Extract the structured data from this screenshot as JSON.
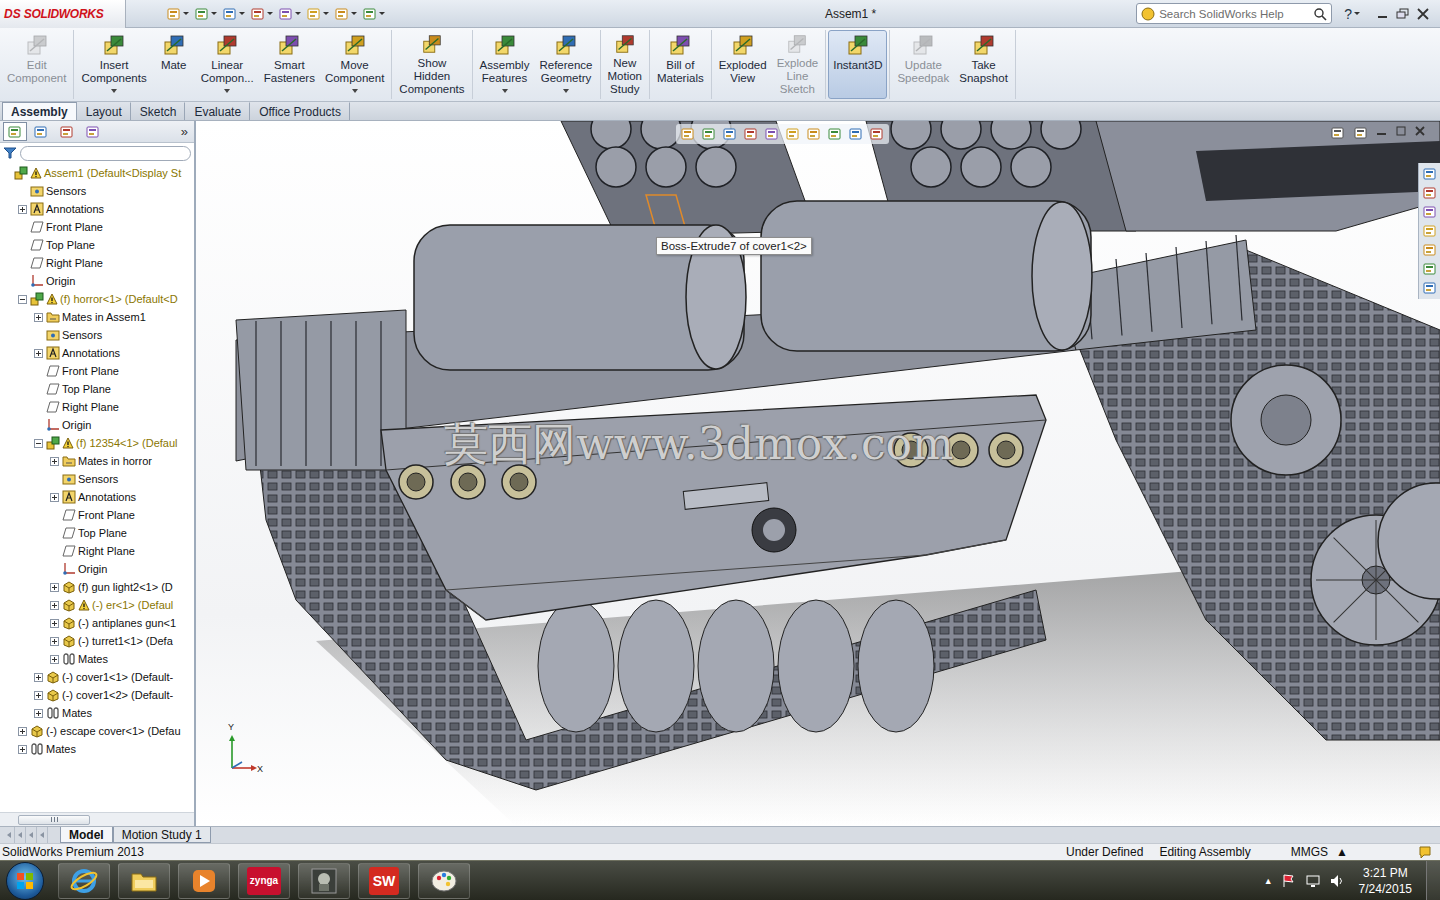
{
  "app": {
    "logo_mark": "DS",
    "logo_name": "SOLIDWORKS"
  },
  "window": {
    "title": "Assem1 *"
  },
  "search": {
    "placeholder": "Search SolidWorks Help"
  },
  "help": {
    "label": "?"
  },
  "ribbon": {
    "groups": [
      {
        "buttons": [
          {
            "label": "Edit\nComponent",
            "disabled": true,
            "dropdown": false,
            "selected": false
          }
        ]
      },
      {
        "buttons": [
          {
            "label": "Insert\nComponents",
            "disabled": false,
            "dropdown": true,
            "selected": false
          },
          {
            "label": "Mate",
            "disabled": false,
            "dropdown": false,
            "selected": false
          },
          {
            "label": "Linear\nCompon...",
            "disabled": false,
            "dropdown": true,
            "selected": false
          },
          {
            "label": "Smart\nFasteners",
            "disabled": false,
            "dropdown": false,
            "selected": false
          },
          {
            "label": "Move\nComponent",
            "disabled": false,
            "dropdown": true,
            "selected": false
          }
        ]
      },
      {
        "buttons": [
          {
            "label": "Show\nHidden\nComponents",
            "disabled": false,
            "dropdown": false,
            "selected": false
          }
        ]
      },
      {
        "buttons": [
          {
            "label": "Assembly\nFeatures",
            "disabled": false,
            "dropdown": true,
            "selected": false
          },
          {
            "label": "Reference\nGeometry",
            "disabled": false,
            "dropdown": true,
            "selected": false
          }
        ]
      },
      {
        "buttons": [
          {
            "label": "New\nMotion\nStudy",
            "disabled": false,
            "dropdown": false,
            "selected": false
          }
        ]
      },
      {
        "buttons": [
          {
            "label": "Bill of\nMaterials",
            "disabled": false,
            "dropdown": false,
            "selected": false
          }
        ]
      },
      {
        "buttons": [
          {
            "label": "Exploded\nView",
            "disabled": false,
            "dropdown": false,
            "selected": false
          },
          {
            "label": "Explode\nLine\nSketch",
            "disabled": true,
            "dropdown": false,
            "selected": false
          }
        ]
      },
      {
        "buttons": [
          {
            "label": "Instant3D",
            "disabled": false,
            "dropdown": false,
            "selected": true
          }
        ]
      },
      {
        "buttons": [
          {
            "label": "Update\nSpeedpak",
            "disabled": true,
            "dropdown": false,
            "selected": false
          },
          {
            "label": "Take\nSnapshot",
            "disabled": false,
            "dropdown": false,
            "selected": false
          }
        ]
      }
    ]
  },
  "command_tabs": [
    {
      "label": "Assembly",
      "selected": true
    },
    {
      "label": "Layout",
      "selected": false
    },
    {
      "label": "Sketch",
      "selected": false
    },
    {
      "label": "Evaluate",
      "selected": false
    },
    {
      "label": "Office Products",
      "selected": false
    }
  ],
  "feature_manager": {
    "more": "»",
    "tree": [
      {
        "label": "Assem1  (Default<Display St",
        "level": 0,
        "kind": "assembly",
        "expander": "none",
        "warning": true
      },
      {
        "label": "Sensors",
        "level": 1,
        "kind": "sensor",
        "expander": "none",
        "warning": false
      },
      {
        "label": "Annotations",
        "level": 1,
        "kind": "annotation",
        "expander": "collapsed",
        "warning": false
      },
      {
        "label": "Front Plane",
        "level": 1,
        "kind": "plane",
        "expander": "none",
        "warning": false
      },
      {
        "label": "Top Plane",
        "level": 1,
        "kind": "plane",
        "expander": "none",
        "warning": false
      },
      {
        "label": "Right Plane",
        "level": 1,
        "kind": "plane",
        "expander": "none",
        "warning": false
      },
      {
        "label": "Origin",
        "level": 1,
        "kind": "origin",
        "expander": "none",
        "warning": false
      },
      {
        "label": "(f) horror<1> (Default<D",
        "level": 1,
        "kind": "assembly",
        "expander": "expanded",
        "warning": true
      },
      {
        "label": "Mates in Assem1",
        "level": 2,
        "kind": "folder",
        "expander": "collapsed",
        "warning": false
      },
      {
        "label": "Sensors",
        "level": 2,
        "kind": "sensor",
        "expander": "none",
        "warning": false
      },
      {
        "label": "Annotations",
        "level": 2,
        "kind": "annotation",
        "expander": "collapsed",
        "warning": false
      },
      {
        "label": "Front Plane",
        "level": 2,
        "kind": "plane",
        "expander": "none",
        "warning": false
      },
      {
        "label": "Top Plane",
        "level": 2,
        "kind": "plane",
        "expander": "none",
        "warning": false
      },
      {
        "label": "Right Plane",
        "level": 2,
        "kind": "plane",
        "expander": "none",
        "warning": false
      },
      {
        "label": "Origin",
        "level": 2,
        "kind": "origin",
        "expander": "none",
        "warning": false
      },
      {
        "label": "(f) 12354<1> (Defaul",
        "level": 2,
        "kind": "assembly",
        "expander": "expanded",
        "warning": true
      },
      {
        "label": "Mates in horror",
        "level": 3,
        "kind": "folder",
        "expander": "collapsed",
        "warning": false
      },
      {
        "label": "Sensors",
        "level": 3,
        "kind": "sensor",
        "expander": "none",
        "warning": false
      },
      {
        "label": "Annotations",
        "level": 3,
        "kind": "annotation",
        "expander": "collapsed",
        "warning": false
      },
      {
        "label": "Front Plane",
        "level": 3,
        "kind": "plane",
        "expander": "none",
        "warning": false
      },
      {
        "label": "Top Plane",
        "level": 3,
        "kind": "plane",
        "expander": "none",
        "warning": false
      },
      {
        "label": "Right Plane",
        "level": 3,
        "kind": "plane",
        "expander": "none",
        "warning": false
      },
      {
        "label": "Origin",
        "level": 3,
        "kind": "origin",
        "expander": "none",
        "warning": false
      },
      {
        "label": "(f) gun light2<1> (D",
        "level": 3,
        "kind": "part",
        "expander": "collapsed",
        "warning": false
      },
      {
        "label": "(-) er<1> (Defaul",
        "level": 3,
        "kind": "part",
        "expander": "collapsed",
        "warning": true
      },
      {
        "label": "(-) antiplanes gun<1",
        "level": 3,
        "kind": "part",
        "expander": "collapsed",
        "warning": false
      },
      {
        "label": "(-) turret1<1> (Defa",
        "level": 3,
        "kind": "part",
        "expander": "collapsed",
        "warning": false
      },
      {
        "label": "Mates",
        "level": 3,
        "kind": "mates",
        "expander": "collapsed",
        "warning": false
      },
      {
        "label": "(-) cover1<1> (Default-",
        "level": 2,
        "kind": "part",
        "expander": "collapsed",
        "warning": false
      },
      {
        "label": "(-) cover1<2> (Default-",
        "level": 2,
        "kind": "part",
        "expander": "collapsed",
        "warning": false
      },
      {
        "label": "Mates",
        "level": 2,
        "kind": "mates",
        "expander": "collapsed",
        "warning": false
      },
      {
        "label": "(-) escape cover<1> (Defau",
        "level": 1,
        "kind": "part",
        "expander": "collapsed",
        "warning": false
      },
      {
        "label": "Mates",
        "level": 1,
        "kind": "mates",
        "expander": "collapsed",
        "warning": false
      }
    ]
  },
  "viewport": {
    "tooltip": "Boss-Extrude7 of cover1<2>",
    "watermark": "莫西网www.3dmox.com",
    "triad": {
      "y": "Y",
      "x": "X"
    }
  },
  "bottom_tabs": [
    {
      "label": "Model",
      "selected": true
    },
    {
      "label": "Motion Study 1",
      "selected": false
    }
  ],
  "status_bar": {
    "product": "SolidWorks Premium 2013",
    "state": "Under Defined",
    "mode": "Editing Assembly",
    "units": "MMGS",
    "units_arrow": "▲"
  },
  "taskbar": {
    "apps": [
      {
        "kind": "ie"
      },
      {
        "kind": "explorer"
      },
      {
        "kind": "media"
      },
      {
        "kind": "zynga",
        "label": "zynga"
      },
      {
        "kind": "game"
      },
      {
        "kind": "solidworks",
        "label": "SW"
      },
      {
        "kind": "paint"
      }
    ],
    "tray_arrow": "▲",
    "time": "3:21 PM",
    "date": "7/24/2015"
  }
}
